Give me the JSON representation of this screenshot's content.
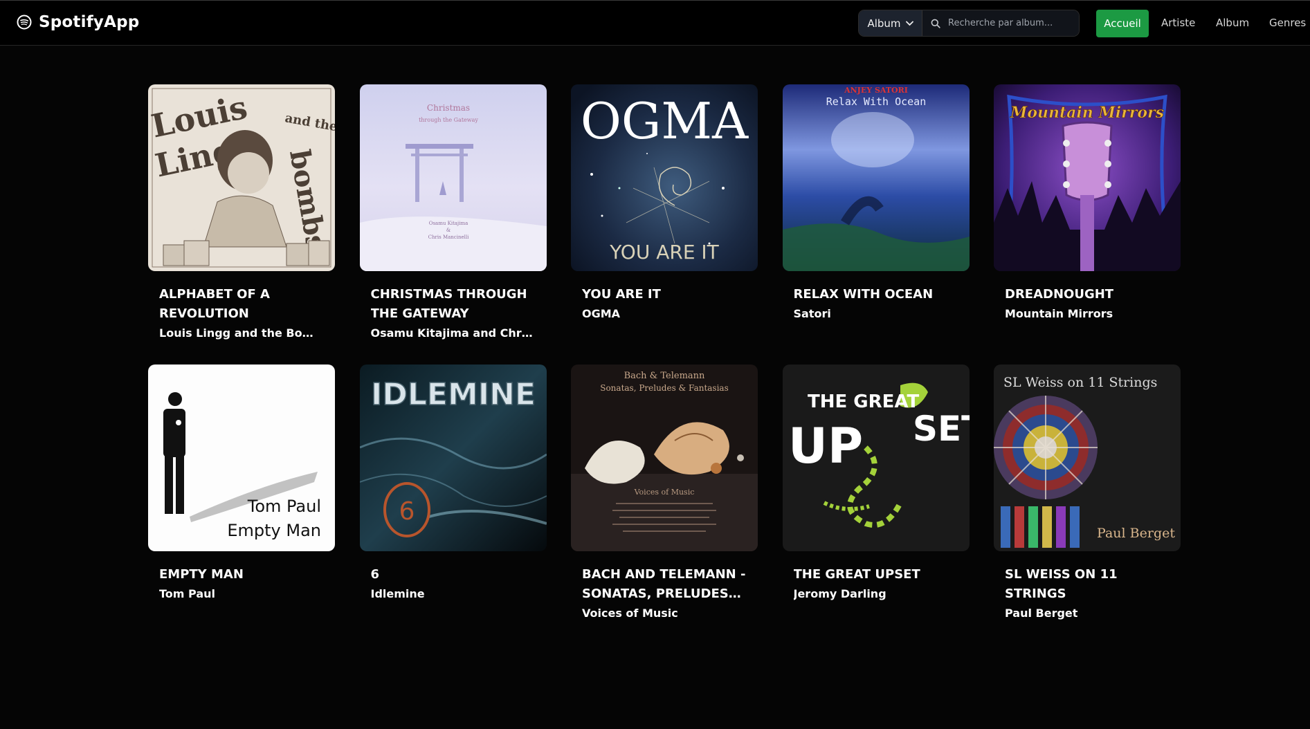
{
  "brand": {
    "name": "SpotifyApp",
    "icon": "spotify-icon"
  },
  "search": {
    "filter_selected": "Album",
    "placeholder": "Recherche par album..."
  },
  "nav": {
    "home": "Accueil",
    "artist": "Artiste",
    "album": "Album",
    "genres": "Genres"
  },
  "colors": {
    "accent": "#1c9a43",
    "background": "#050505"
  },
  "albums": [
    {
      "title": "Alphabet of a Revolution",
      "artist": "Louis Lingg and the Bombs",
      "cover": {
        "lines": [
          "Louis",
          "Lingg",
          "and the",
          "bombs"
        ]
      }
    },
    {
      "title": "Christmas Through the Gateway",
      "artist": "Osamu Kitajima and Chris…",
      "cover": {
        "lines": [
          "Christmas",
          "through the Gateway",
          "Osamu Kitajima",
          "&",
          "Chris Mancinelli"
        ]
      }
    },
    {
      "title": "You Are It",
      "artist": "OGMA",
      "cover": {
        "lines": [
          "OGMA",
          "YOU ARE IT"
        ]
      }
    },
    {
      "title": "Relax With Ocean",
      "artist": "Satori",
      "cover": {
        "lines": [
          "ANJEY SATORI",
          "Relax With Ocean"
        ]
      }
    },
    {
      "title": "Dreadnought",
      "artist": "Mountain Mirrors",
      "cover": {
        "lines": [
          "Mountain Mirrors"
        ]
      }
    },
    {
      "title": "Empty Man",
      "artist": "Tom Paul",
      "cover": {
        "lines": [
          "Tom Paul",
          "Empty Man"
        ]
      }
    },
    {
      "title": "6",
      "artist": "Idlemine",
      "cover": {
        "lines": [
          "IDLEMINE",
          "6"
        ]
      }
    },
    {
      "title": "Bach and Telemann - Sonatas, Preludes…",
      "artist": "Voices of Music",
      "cover": {
        "lines": [
          "Bach & Telemann",
          "Sonatas, Preludes & Fantasias",
          "Voices of Music"
        ]
      }
    },
    {
      "title": "The Great Upset",
      "artist": "Jeromy Darling",
      "cover": {
        "lines": [
          "THE GREAT",
          "UP",
          "SET"
        ]
      }
    },
    {
      "title": "SL Weiss on 11 Strings",
      "artist": "Paul Berget",
      "cover": {
        "lines": [
          "SL Weiss on 11 Strings",
          "Paul Berget"
        ]
      }
    }
  ]
}
